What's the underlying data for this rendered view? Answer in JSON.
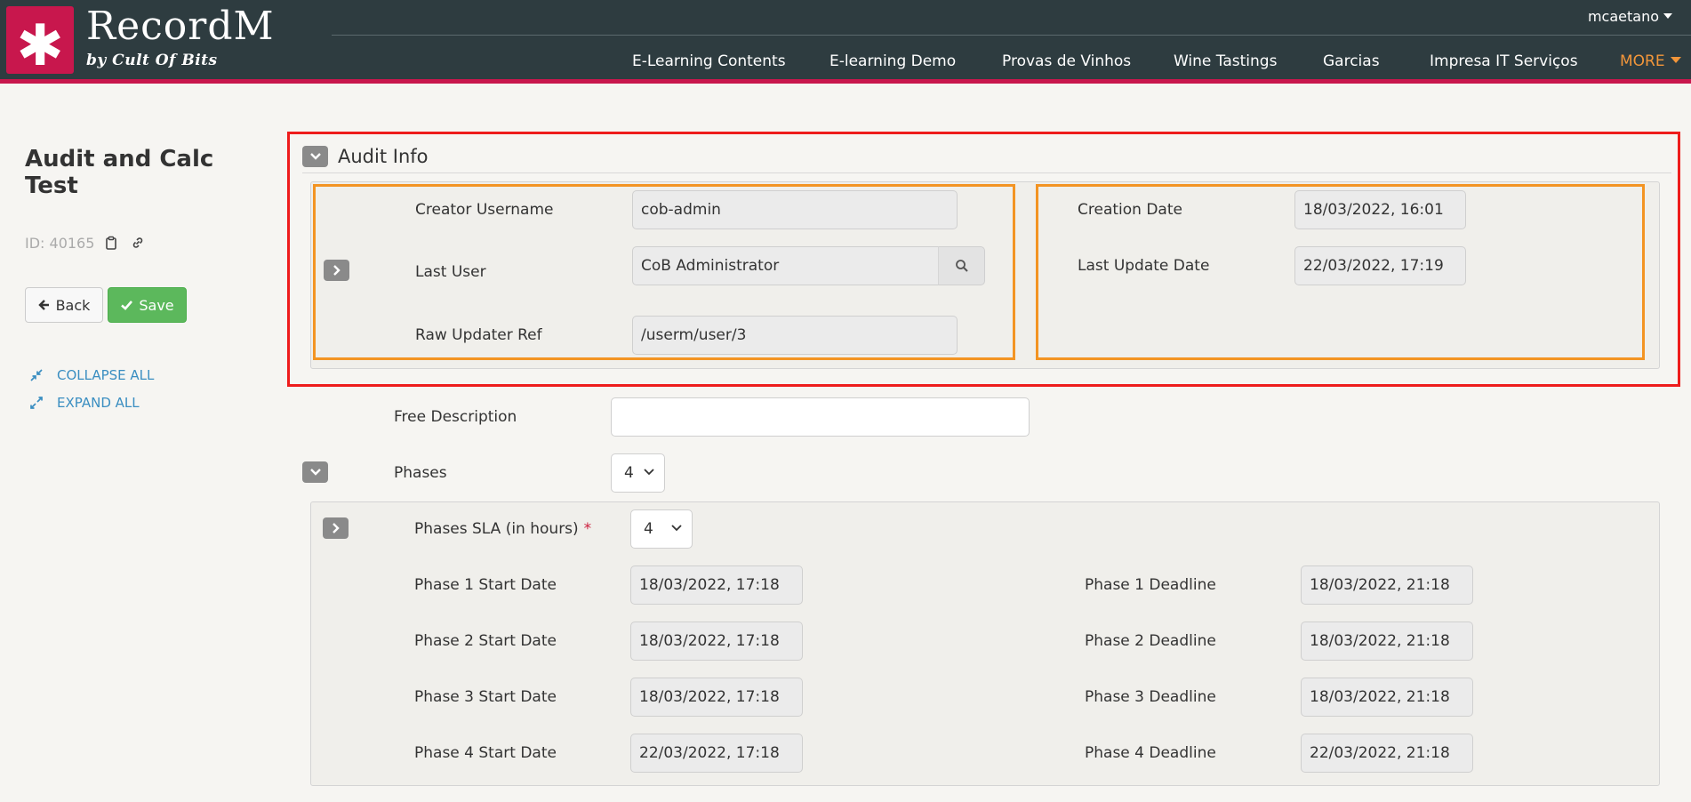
{
  "app": {
    "logo_glyph": "✱",
    "name": "RecordM",
    "tagline": "by Cult Of Bits",
    "user": "mcaetano",
    "nav": [
      "E-Learning Contents",
      "E-learning Demo",
      "Provas de Vinhos",
      "Wine Tastings",
      "Garcias",
      "Impresa IT Serviços"
    ],
    "more_label": "MORE"
  },
  "record": {
    "title": "Audit and Calc Test",
    "id_label": "ID: 40165",
    "back_label": "Back",
    "save_label": "Save",
    "collapse_all": "COLLAPSE ALL",
    "expand_all": "EXPAND ALL"
  },
  "audit": {
    "title": "Audit Info",
    "creator_username_label": "Creator Username",
    "creator_username": "cob-admin",
    "last_user_label": "Last User",
    "last_user": "CoB Administrator",
    "raw_updater_ref_label": "Raw Updater Ref",
    "raw_updater_ref": "/userm/user/3",
    "creation_date_label": "Creation Date",
    "creation_date": "18/03/2022, 16:01",
    "last_update_date_label": "Last Update Date",
    "last_update_date": "22/03/2022, 17:19"
  },
  "form": {
    "free_description_label": "Free Description",
    "free_description": "",
    "phases_label": "Phases",
    "phases_value": "4",
    "phases_sla_label": "Phases SLA (in hours)",
    "required_mark": "*",
    "phases_sla_value": "4",
    "phases": [
      {
        "start_label": "Phase 1 Start Date",
        "start": "18/03/2022, 17:18",
        "deadline_label": "Phase 1 Deadline",
        "deadline": "18/03/2022, 21:18"
      },
      {
        "start_label": "Phase 2 Start Date",
        "start": "18/03/2022, 17:18",
        "deadline_label": "Phase 2 Deadline",
        "deadline": "18/03/2022, 21:18"
      },
      {
        "start_label": "Phase 3 Start Date",
        "start": "18/03/2022, 17:18",
        "deadline_label": "Phase 3 Deadline",
        "deadline": "18/03/2022, 21:18"
      },
      {
        "start_label": "Phase 4 Start Date",
        "start": "22/03/2022, 17:18",
        "deadline_label": "Phase 4 Deadline",
        "deadline": "22/03/2022, 21:18"
      }
    ]
  },
  "colors": {
    "header_bg": "#2e3c40",
    "brand_accent": "#c8174d",
    "more_link": "#f2963a",
    "save_button": "#5cb85c",
    "link_blue": "#3a8ec1",
    "highlight_red": "#ee1c1c",
    "highlight_orange": "#f39423"
  },
  "icons": [
    "asterisk-logo-icon",
    "caret-down-icon",
    "clipboard-icon",
    "link-icon",
    "arrow-left-icon",
    "check-icon",
    "collapse-icon",
    "expand-icon",
    "chevron-down-icon",
    "chevron-right-icon",
    "search-icon"
  ]
}
